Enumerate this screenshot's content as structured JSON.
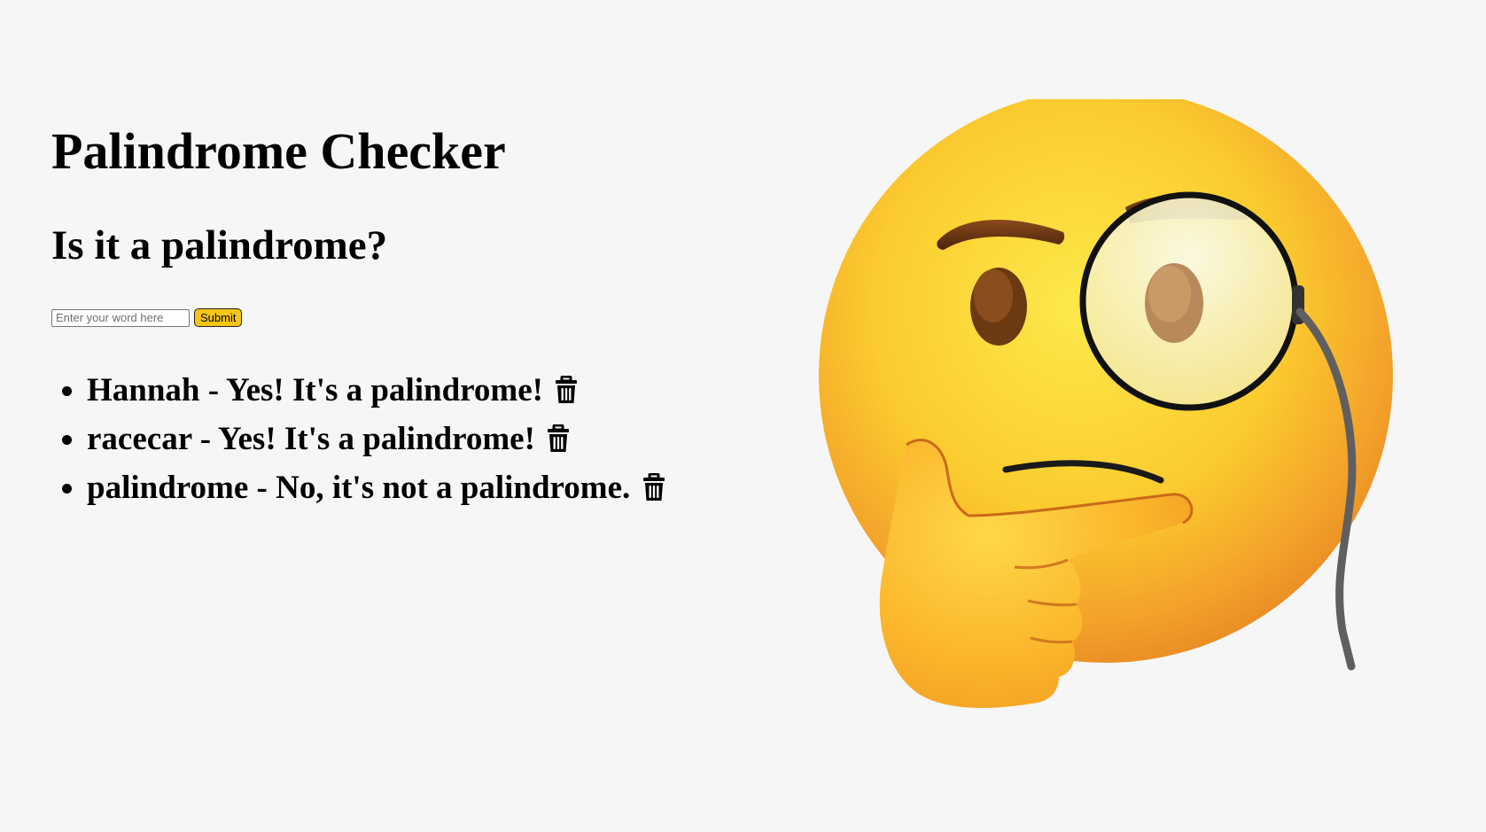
{
  "header": {
    "title": "Palindrome Checker",
    "subtitle": "Is it a palindrome?"
  },
  "form": {
    "input_placeholder": "Enter your word here",
    "input_value": "",
    "submit_label": "Submit",
    "submit_color": "#f5c518"
  },
  "results": [
    {
      "text": "Hannah - Yes! It's a palindrome!",
      "action_icon": "trash-icon"
    },
    {
      "text": "racecar - Yes! It's a palindrome!",
      "action_icon": "trash-icon"
    },
    {
      "text": "palindrome - No, it's not a palindrome.",
      "action_icon": "trash-icon"
    }
  ],
  "illustration": {
    "icon": "thinking-face-with-monocle-icon"
  },
  "colors": {
    "background": "#f6f6f6",
    "accent": "#f5c518"
  }
}
